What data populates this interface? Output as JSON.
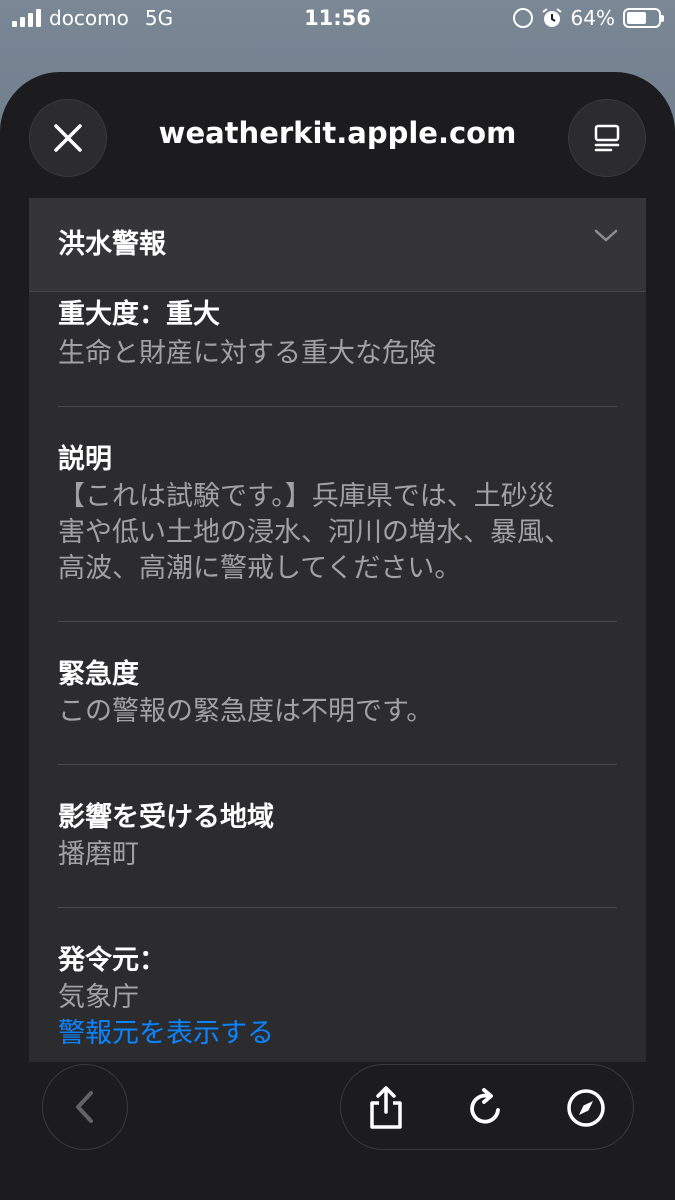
{
  "status_bar": {
    "carrier": "docomo",
    "network": "5G",
    "time": "11:56",
    "battery_percent": "64%",
    "battery_level": 0.64,
    "icons": [
      "signal-icon",
      "rotation-lock-icon",
      "alarm-icon",
      "battery-icon"
    ]
  },
  "header": {
    "url": "weatherkit.apple.com",
    "icons": [
      "close-icon",
      "reader-mode-icon"
    ]
  },
  "alert": {
    "title": "洪水警報",
    "sections": [
      {
        "label": "重大度：重大",
        "value": "生命と財産に対する重大な危険"
      },
      {
        "label": "説明",
        "value_lines": [
          "【これは試験です。】兵庫県では、土砂災",
          "害や低い土地の浸水、河川の増水、暴風、",
          "高波、高潮に警戒してください。"
        ]
      },
      {
        "label": "緊急度",
        "value": "この警報の緊急度は不明です。"
      },
      {
        "label": "影響を受ける地域",
        "value": "播磨町"
      },
      {
        "label": "発令元：",
        "value": "気象庁",
        "link": "警報元を表示する"
      }
    ]
  },
  "toolbar": {
    "icons": [
      "back-icon",
      "share-icon",
      "reload-icon",
      "compass-icon"
    ]
  },
  "colors": {
    "background": "#1c1c1e",
    "card": "#2c2c2e",
    "secondary_text": "#a1a1a6",
    "link": "#0a84ff"
  }
}
